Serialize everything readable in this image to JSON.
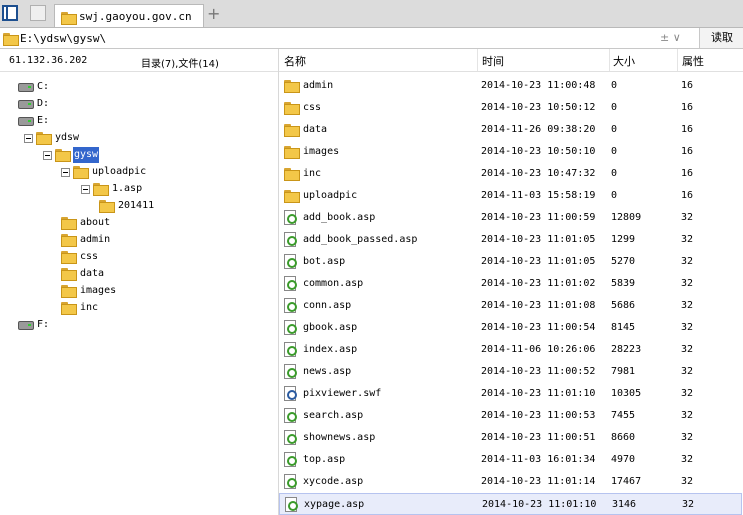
{
  "tab": {
    "title": "swj.gaoyou.gov.cn"
  },
  "address": {
    "path": "E:\\ydsw\\gysw\\",
    "controls": "±  ∨",
    "read_label": "读取"
  },
  "left_header": {
    "ip": "61.132.36.202",
    "stats": "目录(7),文件(14)"
  },
  "tree": [
    {
      "label": "C:",
      "kind": "drive",
      "level": 0,
      "expander": false
    },
    {
      "label": "D:",
      "kind": "drive",
      "level": 0,
      "expander": false
    },
    {
      "label": "E:",
      "kind": "drive",
      "level": 0,
      "expander": false
    },
    {
      "label": "ydsw",
      "kind": "folder",
      "level": 1,
      "expander": true
    },
    {
      "label": "gysw",
      "kind": "folder",
      "level": 2,
      "expander": true,
      "selected": true
    },
    {
      "label": "uploadpic",
      "kind": "folder",
      "level": 3,
      "expander": true
    },
    {
      "label": "1.asp",
      "kind": "folder",
      "level": 4,
      "expander": true
    },
    {
      "label": "201411",
      "kind": "folder",
      "level": 5,
      "expander": false
    },
    {
      "label": "about",
      "kind": "folder",
      "level": 3,
      "expander": false
    },
    {
      "label": "admin",
      "kind": "folder",
      "level": 3,
      "expander": false
    },
    {
      "label": "css",
      "kind": "folder",
      "level": 3,
      "expander": false
    },
    {
      "label": "data",
      "kind": "folder",
      "level": 3,
      "expander": false
    },
    {
      "label": "images",
      "kind": "folder",
      "level": 3,
      "expander": false
    },
    {
      "label": "inc",
      "kind": "folder",
      "level": 3,
      "expander": false
    },
    {
      "label": "F:",
      "kind": "drive",
      "level": 0,
      "expander": false
    }
  ],
  "columns": {
    "name": "名称",
    "time": "时间",
    "size": "大小",
    "attr": "属性"
  },
  "files": [
    {
      "name": "admin",
      "time": "2014-10-23 11:00:48",
      "size": "0",
      "attr": "16",
      "type": "folder"
    },
    {
      "name": "css",
      "time": "2014-10-23 10:50:12",
      "size": "0",
      "attr": "16",
      "type": "folder"
    },
    {
      "name": "data",
      "time": "2014-11-26 09:38:20",
      "size": "0",
      "attr": "16",
      "type": "folder"
    },
    {
      "name": "images",
      "time": "2014-10-23 10:50:10",
      "size": "0",
      "attr": "16",
      "type": "folder"
    },
    {
      "name": "inc",
      "time": "2014-10-23 10:47:32",
      "size": "0",
      "attr": "16",
      "type": "folder"
    },
    {
      "name": "uploadpic",
      "time": "2014-11-03 15:58:19",
      "size": "0",
      "attr": "16",
      "type": "folder"
    },
    {
      "name": "add_book.asp",
      "time": "2014-10-23 11:00:59",
      "size": "12809",
      "attr": "32",
      "type": "asp"
    },
    {
      "name": "add_book_passed.asp",
      "time": "2014-10-23 11:01:05",
      "size": "1299",
      "attr": "32",
      "type": "asp"
    },
    {
      "name": "bot.asp",
      "time": "2014-10-23 11:01:05",
      "size": "5270",
      "attr": "32",
      "type": "asp"
    },
    {
      "name": "common.asp",
      "time": "2014-10-23 11:01:02",
      "size": "5839",
      "attr": "32",
      "type": "asp"
    },
    {
      "name": "conn.asp",
      "time": "2014-10-23 11:01:08",
      "size": "5686",
      "attr": "32",
      "type": "asp"
    },
    {
      "name": "gbook.asp",
      "time": "2014-10-23 11:00:54",
      "size": "8145",
      "attr": "32",
      "type": "asp"
    },
    {
      "name": "index.asp",
      "time": "2014-11-06 10:26:06",
      "size": "28223",
      "attr": "32",
      "type": "asp"
    },
    {
      "name": "news.asp",
      "time": "2014-10-23 11:00:52",
      "size": "7981",
      "attr": "32",
      "type": "asp"
    },
    {
      "name": "pixviewer.swf",
      "time": "2014-10-23 11:01:10",
      "size": "10305",
      "attr": "32",
      "type": "swf"
    },
    {
      "name": "search.asp",
      "time": "2014-10-23 11:00:53",
      "size": "7455",
      "attr": "32",
      "type": "asp"
    },
    {
      "name": "shownews.asp",
      "time": "2014-10-23 11:00:51",
      "size": "8660",
      "attr": "32",
      "type": "asp"
    },
    {
      "name": "top.asp",
      "time": "2014-11-03 16:01:34",
      "size": "4970",
      "attr": "32",
      "type": "asp"
    },
    {
      "name": "xycode.asp",
      "time": "2014-10-23 11:01:14",
      "size": "17467",
      "attr": "32",
      "type": "asp"
    },
    {
      "name": "xypage.asp",
      "time": "2014-10-23 11:01:10",
      "size": "3146",
      "attr": "32",
      "type": "asp",
      "selected": true
    }
  ]
}
